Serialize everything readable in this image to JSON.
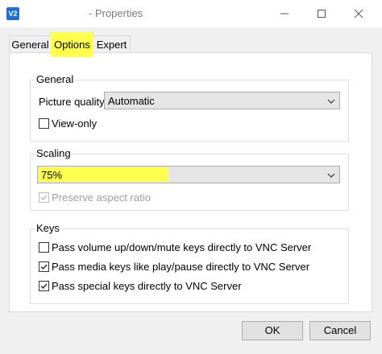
{
  "window": {
    "icon_label": "V2",
    "title": "- Properties"
  },
  "tabs": [
    {
      "label": "General"
    },
    {
      "label": "Options"
    },
    {
      "label": "Expert"
    }
  ],
  "general_group": {
    "legend": "General",
    "picture_quality_label": "Picture quality:",
    "picture_quality_value": "Automatic",
    "view_only_label": "View-only",
    "view_only_checked": false
  },
  "scaling_group": {
    "legend": "Scaling",
    "scaling_value": "75%",
    "preserve_aspect_label": "Preserve aspect ratio",
    "preserve_aspect_checked": true,
    "preserve_aspect_disabled": true
  },
  "keys_group": {
    "legend": "Keys",
    "items": [
      {
        "label": "Pass volume up/down/mute keys directly to VNC Server",
        "checked": false
      },
      {
        "label": "Pass media keys like play/pause directly to VNC Server",
        "checked": true
      },
      {
        "label": "Pass special keys directly to VNC Server",
        "checked": true
      }
    ]
  },
  "buttons": {
    "ok": "OK",
    "cancel": "Cancel"
  },
  "colors": {
    "highlight": "#ffff4d",
    "accent": "#1f6fd1"
  }
}
